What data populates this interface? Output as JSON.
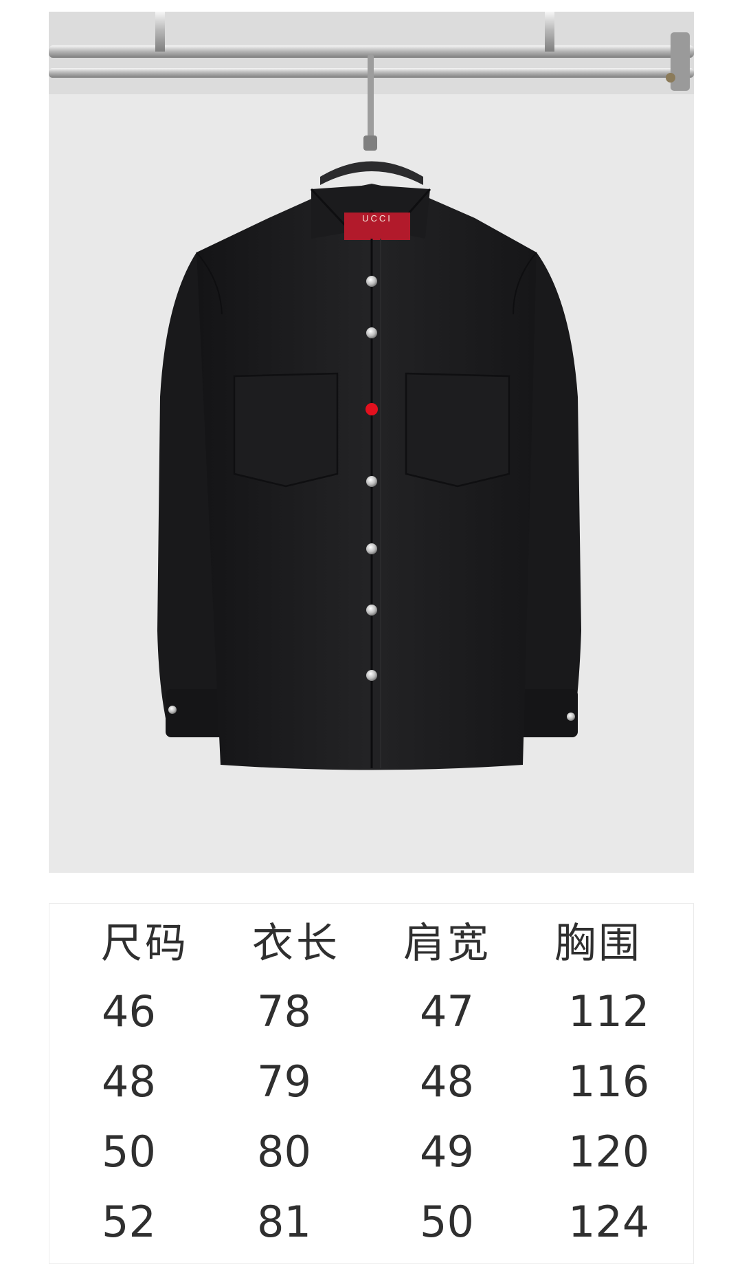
{
  "photo": {
    "label_text": "UCCI"
  },
  "colors": {
    "shirt": "#1f1f21",
    "accent_button": "#e3101e",
    "label": "#b21a2b",
    "text": "#2f2f2f"
  },
  "size_table": {
    "headers": [
      "尺码",
      "衣长",
      "肩宽",
      "胸围"
    ],
    "rows": [
      [
        "46",
        "78",
        "47",
        "112"
      ],
      [
        "48",
        "79",
        "48",
        "116"
      ],
      [
        "50",
        "80",
        "49",
        "120"
      ],
      [
        "52",
        "81",
        "50",
        "124"
      ]
    ]
  }
}
